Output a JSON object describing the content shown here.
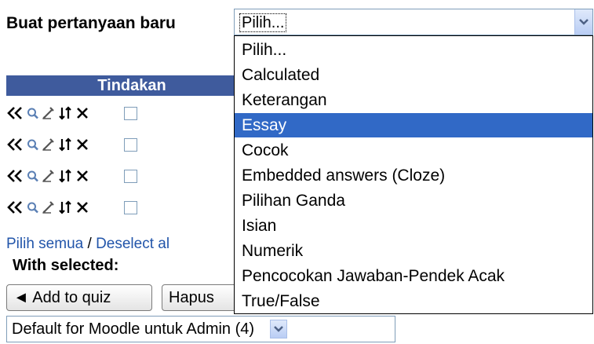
{
  "new_question": {
    "label": "Buat pertanyaan baru",
    "selected_value": "Pilih...",
    "options": [
      "Pilih...",
      "Calculated",
      "Keterangan",
      "Essay",
      "Cocok",
      "Embedded answers (Cloze)",
      "Pilihan Ganda",
      "Isian",
      "Numerik",
      "Pencocokan Jawaban-Pendek Acak",
      "True/False"
    ],
    "highlighted_option": "Essay"
  },
  "table": {
    "header": "Tindakan",
    "row_count": 4,
    "row_icons": [
      "move-left-icon",
      "preview-icon",
      "edit-icon",
      "move-icon",
      "delete-icon"
    ]
  },
  "bulk": {
    "select_all": "Pilih semua",
    "separator": " / ",
    "deselect_all": "Deselect al",
    "with_selected": "With selected:",
    "add_to_quiz": "◄ Add to quiz",
    "delete": "Hapus"
  },
  "category_select": {
    "value": "Default for Moodle untuk Admin (4)"
  },
  "colors": {
    "header_bg": "#3f5b9d",
    "highlight_bg": "#3169c6",
    "link": "#2255aa"
  }
}
